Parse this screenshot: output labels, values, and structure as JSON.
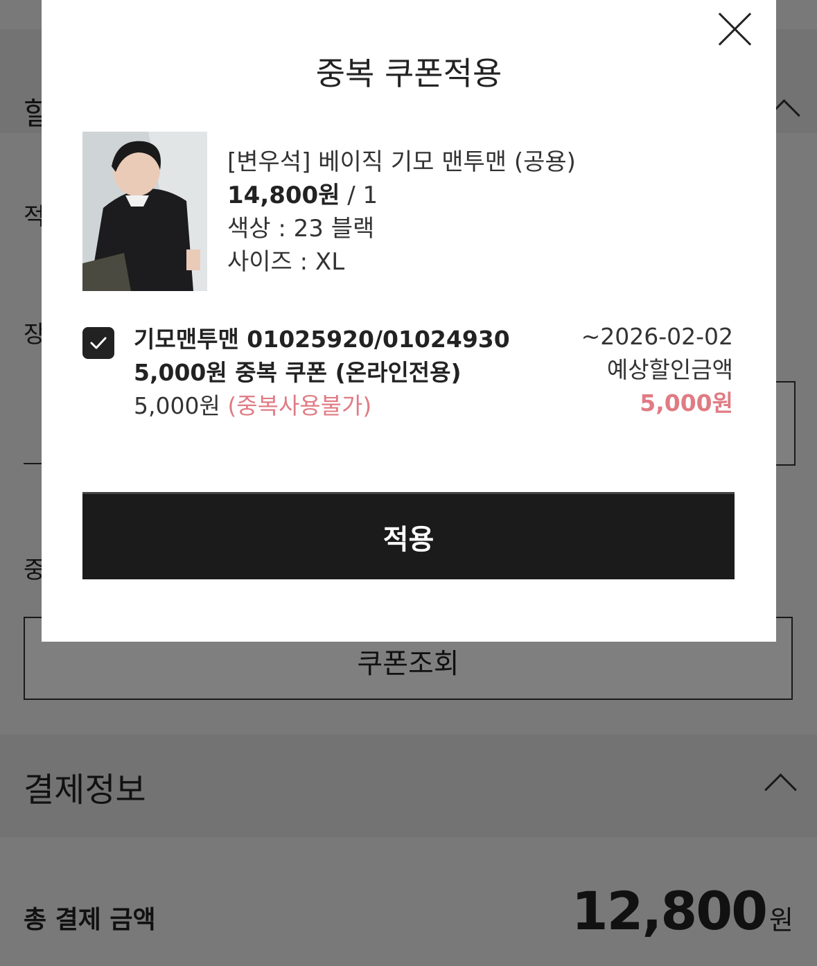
{
  "background": {
    "section1_title": "할",
    "row_labels": [
      "적",
      "장",
      "중"
    ],
    "coupon_lookup_label": "쿠폰조회",
    "payment_section_title": "결제정보",
    "total_label": "총 결제 금액",
    "total_amount": "12,800",
    "total_unit": "원"
  },
  "modal": {
    "title": "중복 쿠폰적용",
    "product": {
      "name": "[변우석] 베이직 기모 맨투맨 (공용)",
      "price": "14,800원",
      "quantity": " / 1",
      "color": "색상 : 23 블랙",
      "size": "사이즈 : XL"
    },
    "coupon": {
      "checked": true,
      "name": "기모맨투맨 01025920/01024930 5,000원 중복 쿠폰 (온라인전용)",
      "price": "5,000원",
      "note": "(중복사용불가)",
      "expiry": "~2026-02-02",
      "discount_label": "예상할인금액",
      "discount_amount": "5,000원"
    },
    "apply_label": "적용"
  },
  "colors": {
    "accent_pink": "#e07b84",
    "button_dark": "#1b1b1b"
  }
}
